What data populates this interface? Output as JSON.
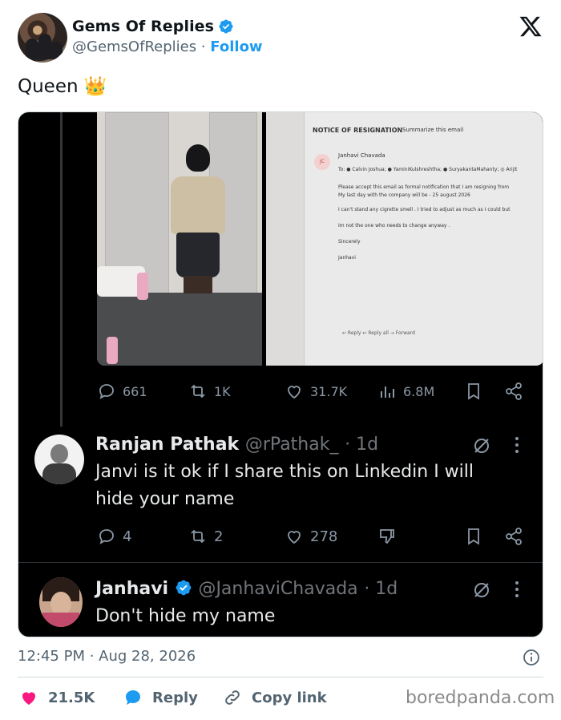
{
  "header": {
    "author_name": "Gems Of Replies",
    "handle": "@GemsOfReplies",
    "separator": "·",
    "follow_label": "Follow"
  },
  "tweet": {
    "text": "Queen",
    "emoji": "👑"
  },
  "screenshot": {
    "email_subject": "NOTICE OF RESIGNATION",
    "summarize_label": "Summarize this email",
    "from_name": "Janhavi Chavada",
    "from_initials": "JC",
    "to_line": "To: ● Calvin Joshua; ● YaminiKulshreshtha; ● SuryakantaMahanty; ◎ Arijit",
    "body_lines": [
      "Please accept this email as formal notification that I am resigning from",
      "My last day with the company will be - 25 august 2026",
      "I can't stand any cigrette smell . I tried to adjust as much as I could but",
      "Im not the one who needs to change anyway .",
      "Sincerely",
      "Janhavi"
    ],
    "actions": "↩ Reply    ↩ Reply all    → Forward"
  },
  "post_stats": {
    "replies": "661",
    "reposts": "1K",
    "likes": "31.7K",
    "views": "6.8M"
  },
  "replies": [
    {
      "name": "Ranjan Pathak",
      "handle": "@rPathak_",
      "time": "· 1d",
      "text": "Janvi is it ok if I share this on Linkedin I will hide your name",
      "replies": "4",
      "reposts": "2",
      "likes": "278"
    },
    {
      "name": "Janhavi",
      "handle": "@JanhaviChavada",
      "time": "· 1d",
      "text": "Don't hide my name"
    }
  ],
  "meta": {
    "timestamp": "12:45 PM · Aug 28, 2026"
  },
  "footer": {
    "likes": "21.5K",
    "reply_label": "Reply",
    "copy_label": "Copy link",
    "watermark": "boredpanda.com"
  },
  "colors": {
    "accent": "#1d9bf0",
    "like_red": "#f91880",
    "card_bg": "#000000",
    "muted": "#536471"
  }
}
